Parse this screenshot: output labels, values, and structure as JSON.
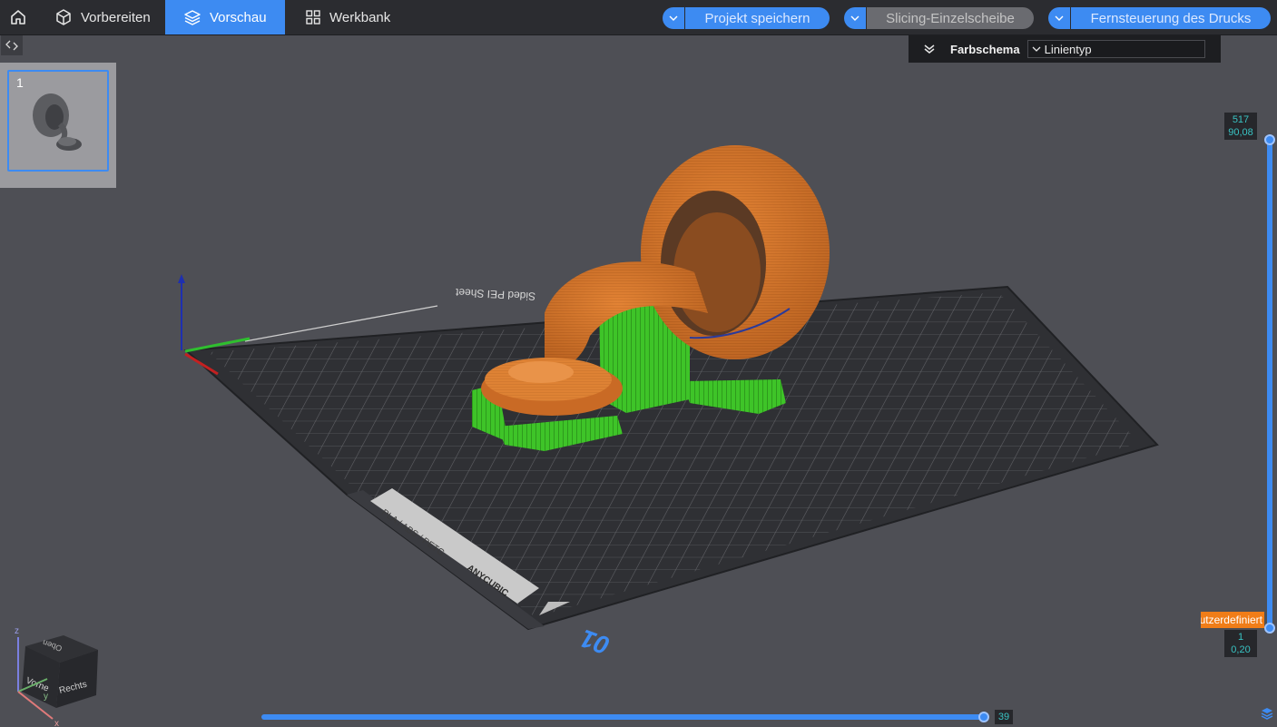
{
  "topbar": {
    "tabs": [
      {
        "label": "Vorbereiten"
      },
      {
        "label": "Vorschau"
      },
      {
        "label": "Werkbank"
      }
    ],
    "actions": [
      {
        "label": "Projekt speichern"
      },
      {
        "label": "Slicing-Einzelscheibe"
      },
      {
        "label": "Fernsteuerung des Drucks"
      }
    ]
  },
  "color_scheme": {
    "title": "Farbschema",
    "value": "Linientyp"
  },
  "objects": [
    {
      "number": "1"
    }
  ],
  "bed": {
    "sheet_text": "Sided PEI Sheet",
    "material_text": "PLA / ABS / PETG",
    "brand_text": "ANYCUBIC",
    "plate_number": "01"
  },
  "view_cube": {
    "top": "Oben",
    "front": "Vorne",
    "right": "Rechts",
    "axis_z": "z",
    "axis_y": "y",
    "axis_x": "x"
  },
  "layer_slider": {
    "top_layer": "517",
    "top_height": "90,08",
    "bottom_layer": "1",
    "bottom_height": "0,20",
    "tag": "Benutzerdefiniert"
  },
  "move_slider": {
    "value": "39"
  },
  "colors": {
    "accent": "#3d8bf2",
    "topbar": "#2b2c30",
    "background": "#4e4f55",
    "model_orange": "#d9782a",
    "support_green": "#3ec428",
    "value_teal": "#39c3c3",
    "tag_orange": "#f07d18"
  }
}
